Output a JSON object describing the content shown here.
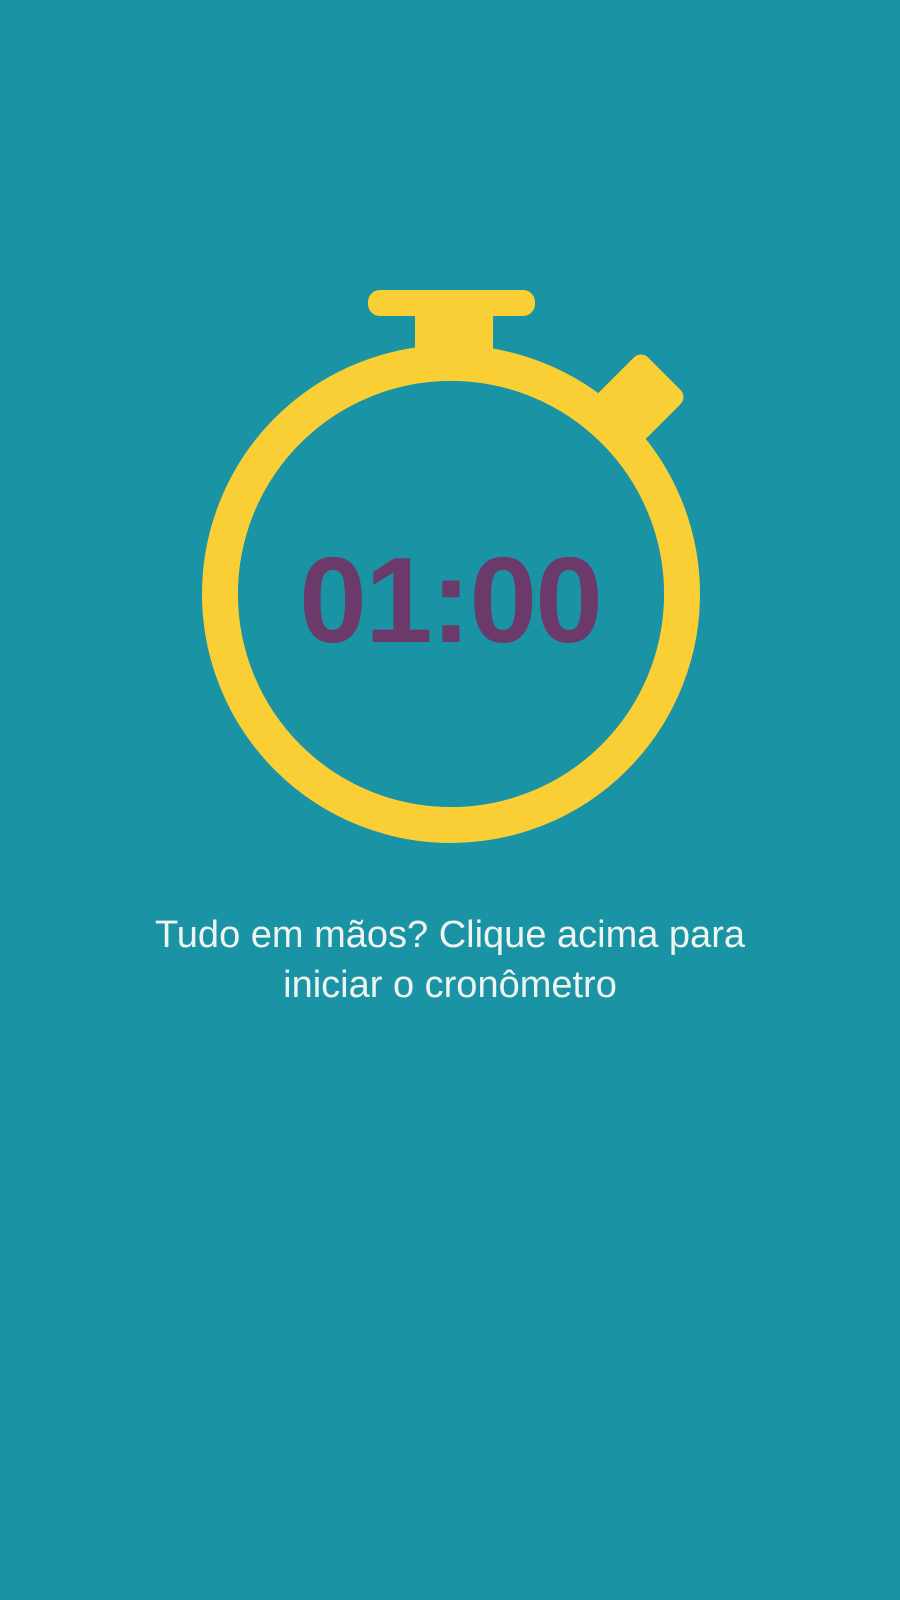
{
  "timer": {
    "time": "01:00"
  },
  "hint": {
    "line1": "Tudo em mãos? Clique acima para",
    "line2": "iniciar o cronômetro"
  },
  "colors": {
    "background": "#1a94a4",
    "stopwatch": "#f9cf35",
    "time_text": "#6b3a6b",
    "hint_text": "#eef4f0"
  },
  "icons": {
    "stopwatch": "stopwatch-icon"
  }
}
